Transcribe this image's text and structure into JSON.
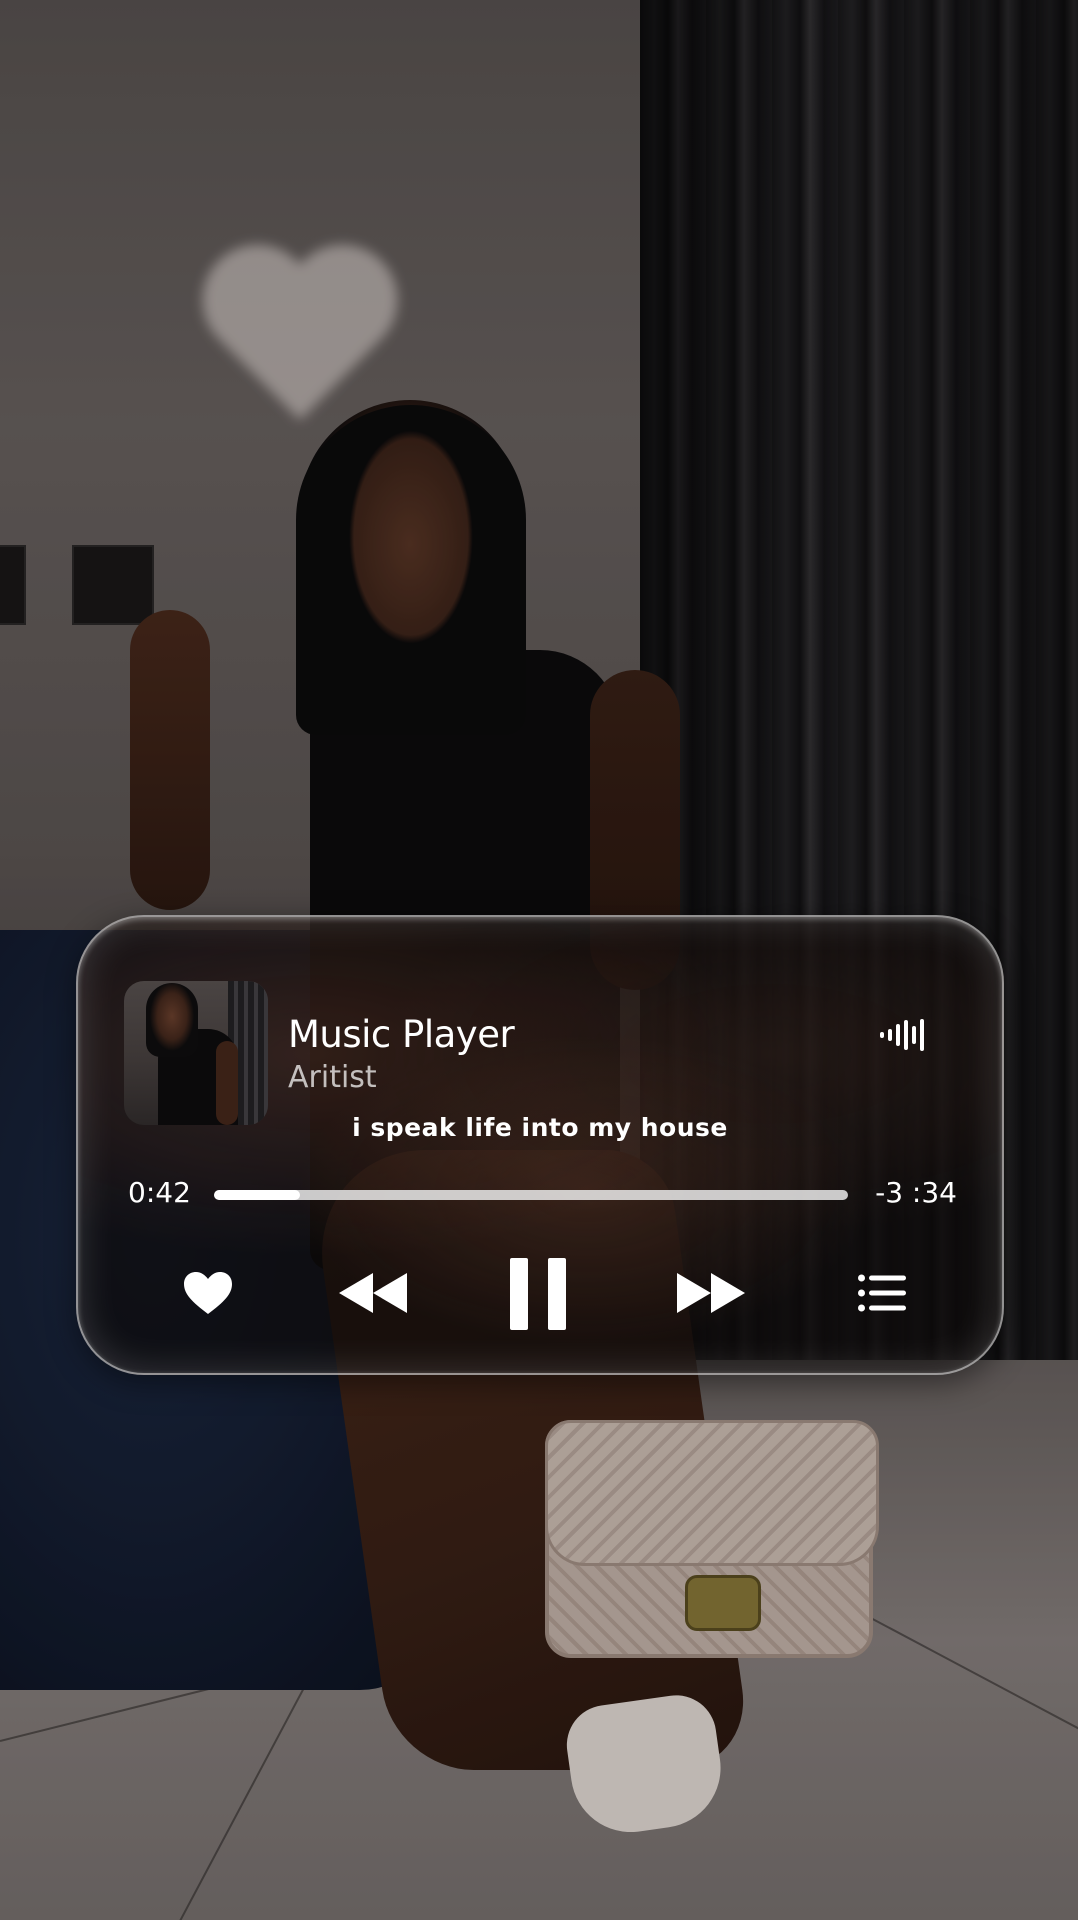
{
  "player": {
    "title": "Music Player",
    "artist": "Aritist",
    "lyric": "i speak life into my house",
    "elapsed": "0:42",
    "remaining": "-3 :34",
    "progress": 0.135,
    "controls": {
      "like_icon": "heart-icon",
      "prev_icon": "rewind-icon",
      "play_icon": "pause-icon",
      "next_icon": "fast-forward-icon",
      "queue_icon": "list-icon",
      "visualizer_icon": "soundwave-icon"
    },
    "colors": {
      "text": "#ffffff",
      "card_border": "#e6e6e6",
      "progress_track": "#ebebeb"
    }
  }
}
